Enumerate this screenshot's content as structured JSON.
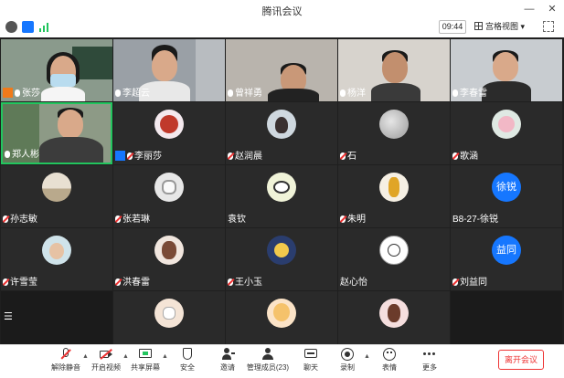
{
  "window": {
    "title": "腾讯会议",
    "minimize": "—",
    "close": "✕"
  },
  "toolbar": {
    "timer": "09:44",
    "view_mode": "宫格视图",
    "view_caret": "▾",
    "icons": [
      "info-icon",
      "shield-icon",
      "signal-icon"
    ]
  },
  "participants": [
    {
      "name": "张莎",
      "type": "video",
      "badge": "host",
      "mic": "on",
      "speaking": false
    },
    {
      "name": "李超云",
      "type": "video",
      "mic": "on",
      "speaking": false
    },
    {
      "name": "曾祥勇",
      "type": "video",
      "mic": "on",
      "speaking": false
    },
    {
      "name": "杨洋",
      "type": "video",
      "mic": "on",
      "speaking": false
    },
    {
      "name": "李春雷",
      "type": "video",
      "mic": "on",
      "speaking": false
    },
    {
      "name": "郑人彬",
      "type": "video",
      "mic": "on",
      "speaking": true
    },
    {
      "name": "李丽莎",
      "type": "avatar",
      "badge": "cohost",
      "mic": "off"
    },
    {
      "name": "赵润晨",
      "type": "avatar",
      "mic": "off"
    },
    {
      "name": "石",
      "type": "avatar",
      "mic": "off"
    },
    {
      "name": "歌涵",
      "type": "avatar",
      "mic": "off"
    },
    {
      "name": "孙志敏",
      "type": "avatar",
      "mic": "off"
    },
    {
      "name": "张若琳",
      "type": "avatar",
      "mic": "off"
    },
    {
      "name": "袁钦",
      "type": "avatar",
      "mic": "none"
    },
    {
      "name": "朱明",
      "type": "avatar",
      "mic": "off"
    },
    {
      "name": "B8-27-徐锐",
      "type": "text-avatar",
      "avatar_text": "徐锐",
      "mic": "none"
    },
    {
      "name": "许雪莹",
      "type": "avatar",
      "mic": "off"
    },
    {
      "name": "洪春雷",
      "type": "avatar",
      "mic": "off"
    },
    {
      "name": "王小玉",
      "type": "avatar",
      "mic": "off"
    },
    {
      "name": "赵心怡",
      "type": "avatar",
      "mic": "none"
    },
    {
      "name": "刘益同",
      "type": "text-avatar",
      "avatar_text": "益同",
      "mic": "off"
    }
  ],
  "side_menu_icon": "☰",
  "bottombar": {
    "items": [
      {
        "label": "解除静音",
        "icon": "mic-muted-icon"
      },
      {
        "label": "开启视频",
        "icon": "camera-off-icon"
      },
      {
        "label": "共享屏幕",
        "icon": "screen-share-icon"
      },
      {
        "label": "安全",
        "icon": "security-shield-icon"
      },
      {
        "label": "邀请",
        "icon": "invite-icon"
      },
      {
        "label": "管理成员(23)",
        "icon": "members-icon"
      },
      {
        "label": "聊天",
        "icon": "chat-icon"
      },
      {
        "label": "录制",
        "icon": "record-icon"
      },
      {
        "label": "表情",
        "icon": "emoji-icon"
      },
      {
        "label": "更多",
        "icon": "more-icon"
      }
    ],
    "leave_label": "离开会议",
    "caret": "▲"
  },
  "colors": {
    "grid_bg": "#1f1f1f",
    "tile_bg": "#2a2a2a",
    "speaking_border": "#22c55e",
    "host_badge": "#f07a1a",
    "accent_blue": "#1677ff",
    "leave_red": "#e33333"
  }
}
